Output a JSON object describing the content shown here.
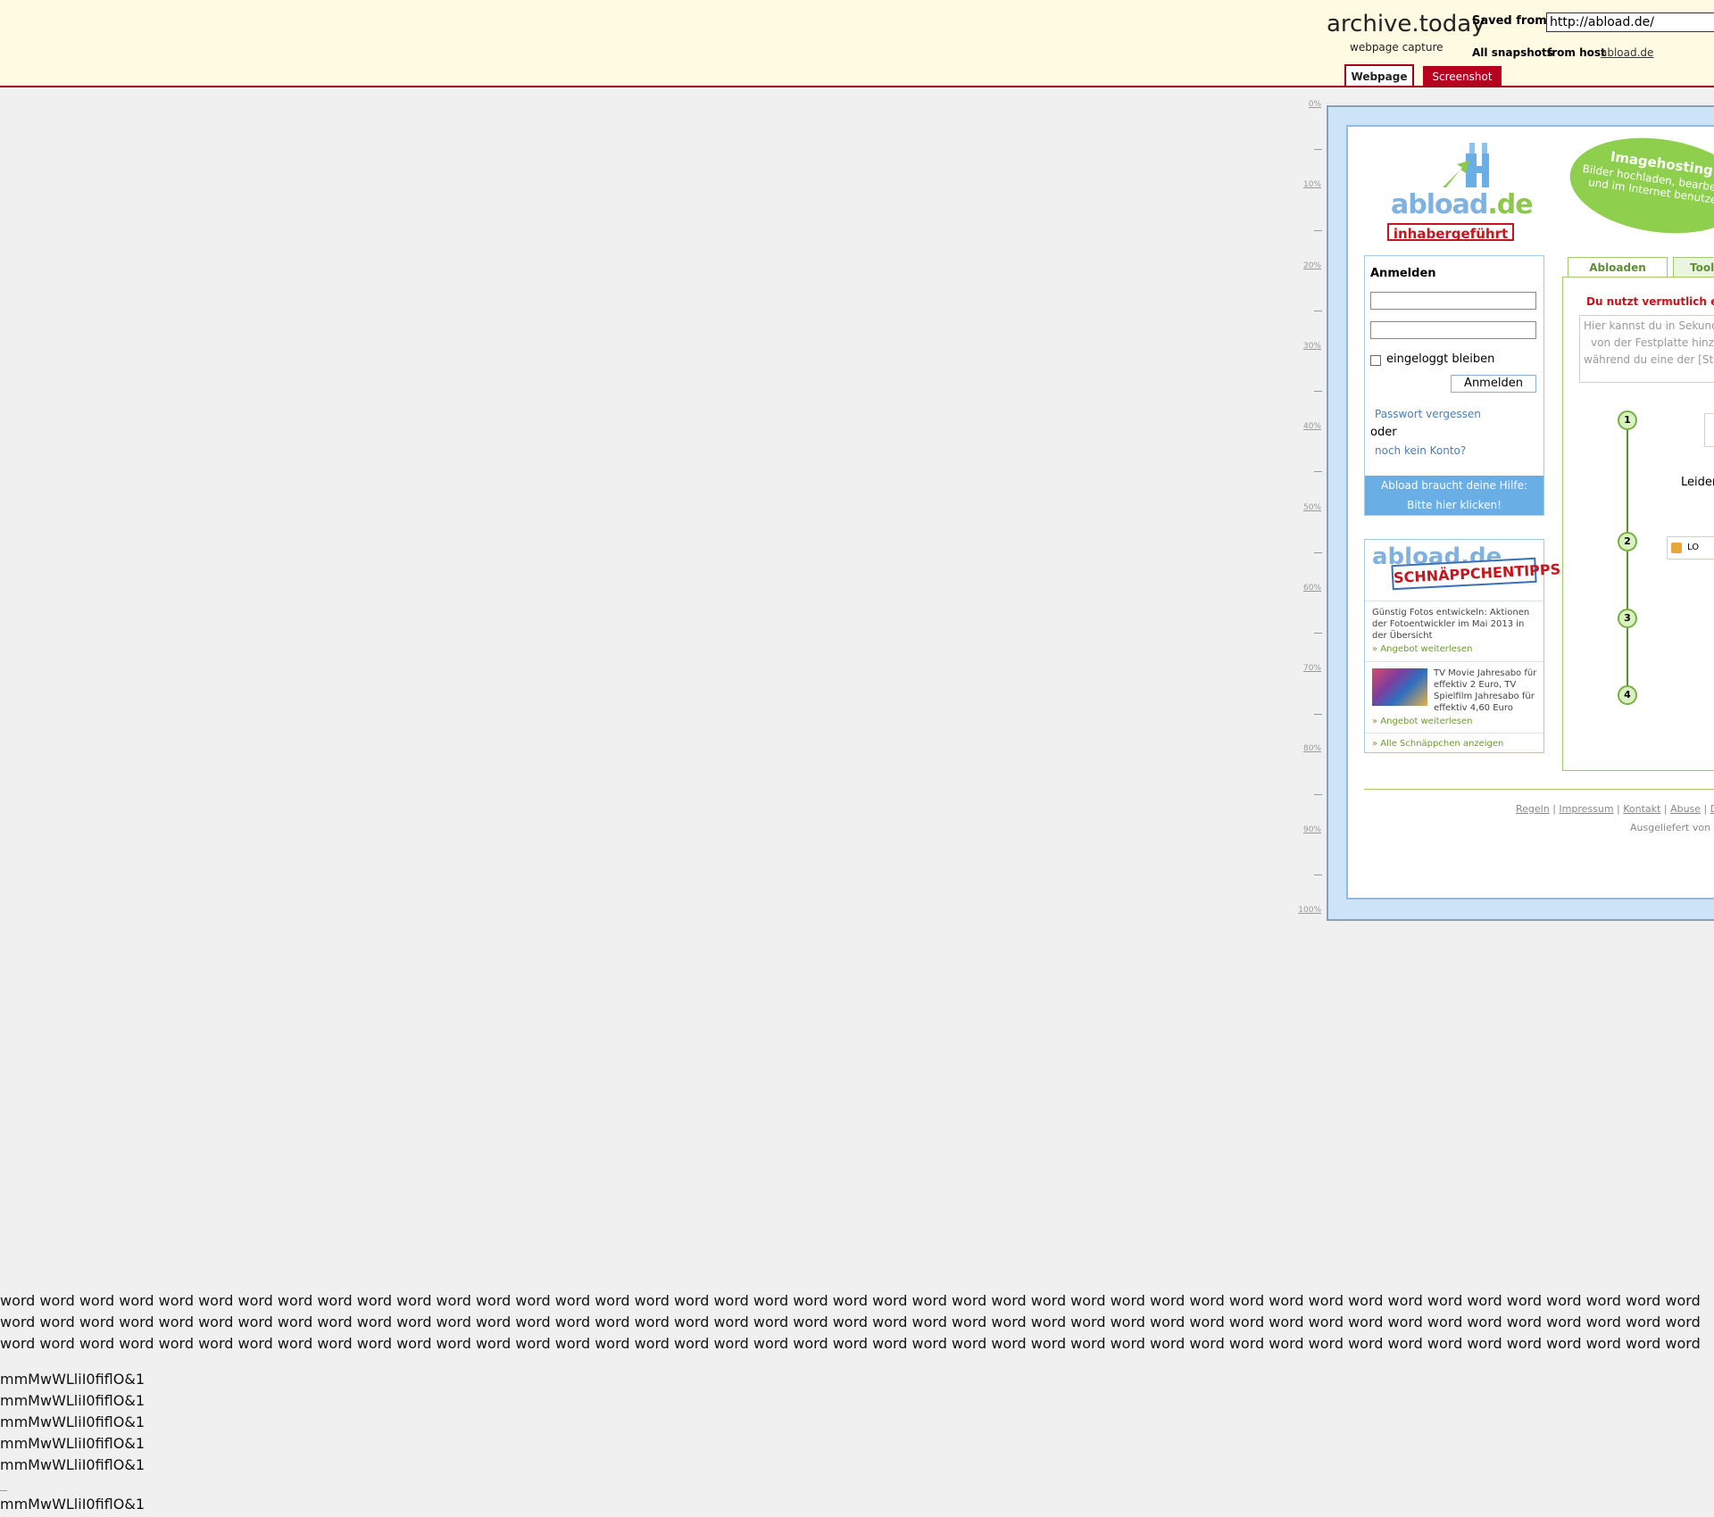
{
  "archive": {
    "title": "archive.today",
    "subtitle": "webpage capture",
    "saved_from_label": "Saved from",
    "saved_from_url": "http://abload.de/",
    "all_snapshots_label": "All snapshots",
    "from_host_label": "from host",
    "host_link": "abload.de",
    "tabs": [
      "Webpage",
      "Screenshot"
    ]
  },
  "ruler": {
    "labels": [
      "0%",
      "10%",
      "20%",
      "30%",
      "40%",
      "50%",
      "60%",
      "70%",
      "80%",
      "90%",
      "100%"
    ]
  },
  "captured_page": {
    "logo_text": "abload",
    "logo_suffix": ".de",
    "logo_stamp": "inhabergeführt",
    "sticker_title": "Imagehosting",
    "sticker_body": "Bilder hochladen, bearbeiten und im Internet benutzen.",
    "login": {
      "title": "Anmelden",
      "remember_label": "eingeloggt bleiben",
      "submit_label": "Anmelden",
      "forgot_link": "Passwort vergessen",
      "or_text": "oder",
      "register_link": "noch kein Konto?",
      "help_line1": "Abload braucht deine Hilfe:",
      "help_line2": "Bitte hier klicken!"
    },
    "deals": {
      "logo_text": "abload.de",
      "stamp_text": "SCHNÄPPCHENTIPPS",
      "item1_text": "Günstig Fotos entwickeln: Aktionen der Fotoentwickler im Mai 2013 in der Übersicht",
      "item1_link": "Angebot weiterlesen",
      "item2_text": "TV Movie Jahresabo für effektiv 2 Euro, TV Spielfilm Jahresabo für effektiv 4,60 Euro",
      "item2_link": "Angebot weiterlesen",
      "all_link": "Alle Schnäppchen anzeigen"
    },
    "right_tabs": [
      "Abloaden",
      "Tool"
    ],
    "warning": "Du nutzt vermutlich ein",
    "textarea_lines": [
      "Hier kannst du in Sekund",
      "von der Festplatte hinzu",
      "während du eine der [Str"
    ],
    "steps": [
      "1",
      "2",
      "3",
      "4"
    ],
    "leider": "Leider",
    "box2_text": "LO",
    "footer_links": [
      "Regeln",
      "Impressum",
      "Kontakt",
      "Abuse",
      "Da"
    ],
    "footer_by": "Ausgeliefert von S"
  },
  "bottom": {
    "paragraph": "word word word word word word word word word word word word word word word word word word word word word word word word word word word word word word word word word word word word word word word word word word word word word word word word word word word word word word word word word word word word word word word word word word word word word word word word word word word word word word word word word word word word word word word word word word word word word word word word word word word word word word word word word word word word word word word word word word word word word word word word word word word word word word word word word word word word word word word word word word word word word word word word word word word word word word word word word word word word word word word word word word word word word word word word",
    "glyph_lines": [
      "mmMwWLliI0fiflO&1",
      "mmMwWLliI0fiflO&1",
      "mmMwWLliI0fiflO&1",
      "mmMwWLliI0fiflO&1",
      "mmMwWLliI0fiflO&1",
      "mmMwWLliI0fiflO&1"
    ]
  }
}
